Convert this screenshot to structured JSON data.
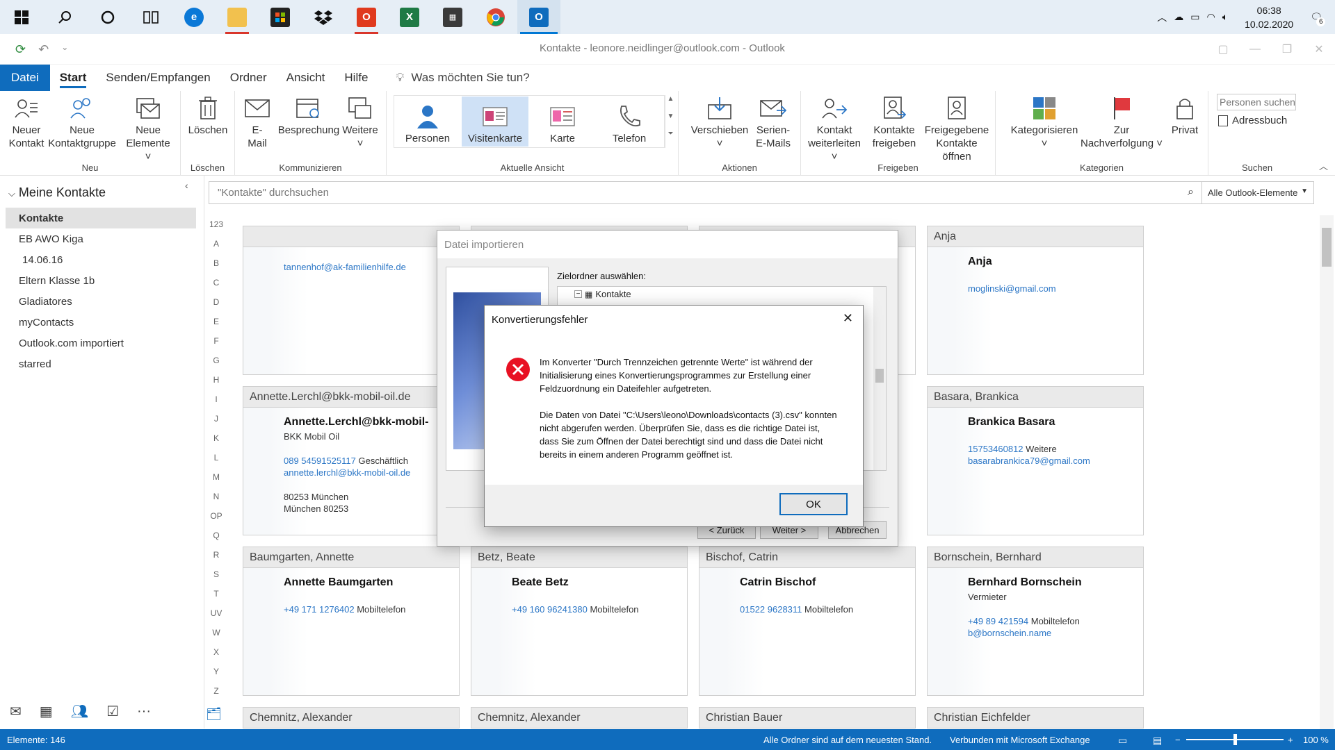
{
  "taskbar": {
    "icons": [
      "windows-start",
      "search",
      "cortana",
      "task-view",
      "edge",
      "file-explorer",
      "store",
      "dropbox",
      "office",
      "excel",
      "calculator",
      "chrome",
      "outlook"
    ],
    "time": "06:38",
    "date": "10.02.2020",
    "notification_count": "6"
  },
  "window": {
    "title": "Kontakte - leonore.neidlinger@outlook.com  -  Outlook"
  },
  "tabs": {
    "file": "Datei",
    "start": "Start",
    "send_receive": "Senden/Empfangen",
    "folder": "Ordner",
    "view": "Ansicht",
    "help": "Hilfe",
    "tell_me": "Was möchten Sie tun?"
  },
  "ribbon": {
    "neu": {
      "label": "Neu",
      "new_contact": [
        "Neuer",
        "Kontakt"
      ],
      "new_group": [
        "Neue",
        "Kontaktgruppe"
      ],
      "new_items": [
        "Neue",
        "Elemente ˅"
      ]
    },
    "loeschen": {
      "label": "Löschen",
      "delete": "Löschen"
    },
    "kommunizieren": {
      "label": "Kommunizieren",
      "email": [
        "E-",
        "Mail"
      ],
      "meeting": "Besprechung",
      "more": [
        "Weitere",
        "˅"
      ]
    },
    "aktuelle_ansicht": {
      "label": "Aktuelle Ansicht",
      "views": [
        "Personen",
        "Visitenkarte",
        "Karte",
        "Telefon"
      ],
      "selected": "Visitenkarte"
    },
    "aktionen": {
      "label": "Aktionen",
      "move": [
        "Verschieben",
        "˅"
      ],
      "mail_merge": [
        "Serien-",
        "E-Mails"
      ]
    },
    "freigeben": {
      "label": "Freigeben",
      "forward": [
        "Kontakt",
        "weiterleiten ˅"
      ],
      "share": [
        "Kontakte",
        "freigeben"
      ],
      "open_shared": [
        "Freigegebene",
        "Kontakte öffnen"
      ]
    },
    "kategorien": {
      "label": "Kategorien",
      "categorize": [
        "Kategorisieren",
        "˅"
      ],
      "followup": [
        "Zur",
        "Nachverfolgung ˅"
      ],
      "private": "Privat"
    },
    "suchen": {
      "label": "Suchen",
      "people_search_placeholder": "Personen suchen",
      "address_book": "Adressbuch"
    }
  },
  "leftnav": {
    "header": "Meine Kontakte",
    "items": [
      "Kontakte",
      "EB AWO Kiga",
      "14.06.16",
      "Eltern Klasse 1b",
      "Gladiatores",
      "myContacts",
      "Outlook.com importiert",
      "starred"
    ],
    "selected": "Kontakte"
  },
  "search": {
    "placeholder": "\"Kontakte\" durchsuchen",
    "scope": "Alle Outlook-Elemente"
  },
  "alphabet": [
    "123",
    "A",
    "B",
    "C",
    "D",
    "E",
    "F",
    "G",
    "H",
    "I",
    "J",
    "K",
    "L",
    "M",
    "N",
    "OP",
    "Q",
    "R",
    "S",
    "T",
    "UV",
    "W",
    "X",
    "Y",
    "Z"
  ],
  "cards": {
    "r1c1": {
      "head": "",
      "lines": [
        "tannenhof@ak-familienhilfe.de"
      ]
    },
    "r1c4": {
      "head": "Anja",
      "name": "Anja",
      "lines": [
        "moglinski@gmail.com"
      ]
    },
    "r2c1": {
      "head": "Annette.Lerchl@bkk-mobil-oil.de",
      "name": "Annette.Lerchl@bkk-mobil-",
      "company": "BKK Mobil Oil",
      "phone": "089 54591525117",
      "phone_type": "Geschäftlich",
      "email": "annette.lerchl@bkk-mobil-oil.de",
      "addr1": "80253 München",
      "addr2": "München 80253"
    },
    "r2c4": {
      "head": "Basara, Brankica",
      "name": "Brankica Basara",
      "phone": "15753460812",
      "phone_type": "Weitere",
      "email": "basarabrankica79@gmail.com"
    },
    "r3c1": {
      "head": "Baumgarten, Annette",
      "name": "Annette Baumgarten",
      "phone": "+49 171 1276402",
      "phone_type": "Mobiltelefon"
    },
    "r3c2": {
      "head": "Betz, Beate",
      "name": "Beate Betz",
      "phone": "+49 160 96241380",
      "phone_type": "Mobiltelefon"
    },
    "r3c3": {
      "head": "Bischof, Catrin",
      "name": "Catrin Bischof",
      "phone": "01522 9628311",
      "phone_type": "Mobiltelefon"
    },
    "r3c4": {
      "head": "Bornschein, Bernhard",
      "name": "Bernhard Bornschein",
      "company": "Vermieter",
      "phone": "+49 89 421594",
      "phone_type": "Mobiltelefon",
      "email": "b@bornschein.name"
    },
    "r4": [
      "Chemnitz, Alexander",
      "Chemnitz, Alexander",
      "Christian Bauer",
      "Christian Eichfelder"
    ]
  },
  "import_dialog": {
    "title": "Datei importieren",
    "folder_label": "Zielordner auswählen:",
    "tree_item": "Kontakte",
    "back": "< Zurück",
    "next": "Weiter >",
    "cancel": "Abbrechen"
  },
  "error_dialog": {
    "title": "Konvertierungsfehler",
    "para1": "Im Konverter \"Durch Trennzeichen getrennte Werte\" ist während der Initialisierung eines Konvertierungsprogrammes zur Erstellung einer Feldzuordnung ein Dateifehler aufgetreten.",
    "para2": "Die Daten von Datei \"C:\\Users\\leono\\Downloads\\contacts (3).csv\" konnten nicht abgerufen werden. Überprüfen Sie, dass es die richtige Datei ist, dass Sie zum Öffnen der Datei berechtigt sind und dass die Datei nicht bereits in einem anderen Programm geöffnet ist.",
    "ok": "OK"
  },
  "status": {
    "items": "Elemente: 146",
    "sync": "Alle Ordner sind auf dem neuesten Stand.",
    "connection": "Verbunden mit Microsoft Exchange",
    "zoom": "100 %"
  },
  "colors": {
    "accent": "#0f6cbd",
    "error": "#e81123",
    "link": "#2b76c6"
  }
}
